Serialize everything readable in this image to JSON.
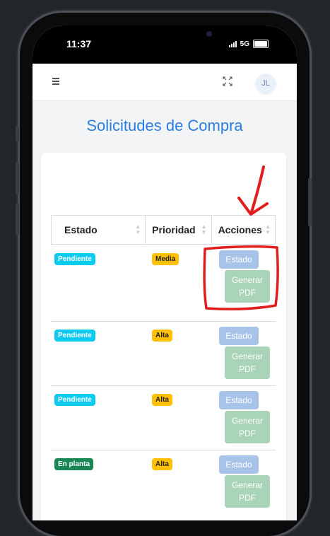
{
  "status_bar": {
    "time": "11:37",
    "network": "5G"
  },
  "header": {
    "menu_icon": "hamburger-icon",
    "expand_icon": "fullscreen-icon",
    "avatar_initials": "JL"
  },
  "page": {
    "title": "Solicitudes de Compra"
  },
  "table": {
    "columns": [
      "Estado",
      "Prioridad",
      "Acciones"
    ],
    "rows": [
      {
        "estado": "Pendiente",
        "prioridad": "Media",
        "btn_estado": "Estado",
        "btn_pdf_1": "Generar",
        "btn_pdf_2": "PDF"
      },
      {
        "estado": "Pendiente",
        "prioridad": "Alta",
        "btn_estado": "Estado",
        "btn_pdf_1": "Generar",
        "btn_pdf_2": "PDF"
      },
      {
        "estado": "Pendiente",
        "prioridad": "Alta",
        "btn_estado": "Estado",
        "btn_pdf_1": "Generar",
        "btn_pdf_2": "PDF"
      },
      {
        "estado": "En planta",
        "prioridad": "Alta",
        "btn_estado": "Estado",
        "btn_pdf_1": "Generar",
        "btn_pdf_2": "PDF"
      }
    ]
  },
  "colors": {
    "title": "#2a7de1",
    "badge_pending": "#0dcaf0",
    "badge_in_plant": "#198754",
    "badge_priority": "#ffc107",
    "annotation": "#e11d1d"
  }
}
